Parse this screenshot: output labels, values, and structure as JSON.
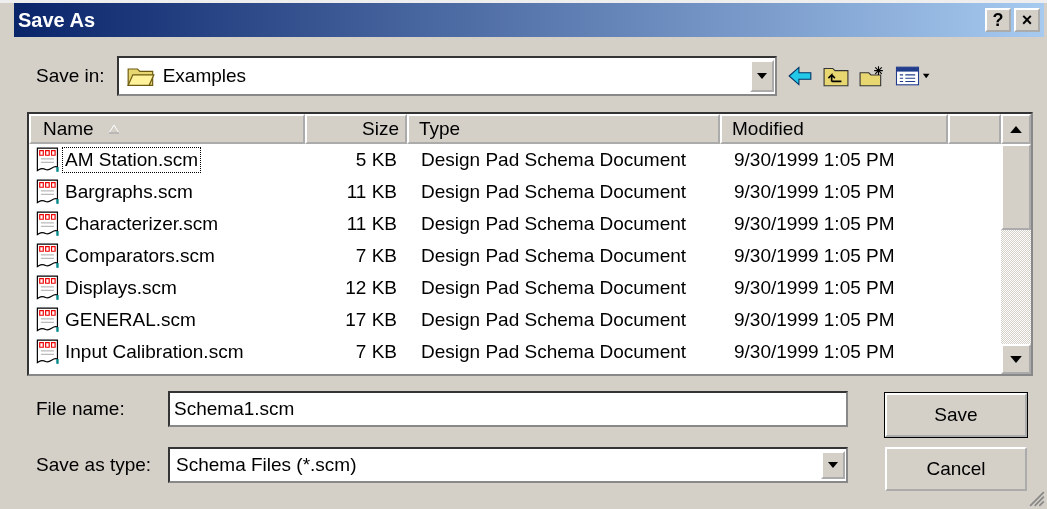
{
  "window": {
    "title": "Save As",
    "help_button": "?",
    "close_button": "×"
  },
  "save_in": {
    "label": "Save in:",
    "value": "Examples"
  },
  "table": {
    "columns": [
      "Name",
      "Size",
      "Type",
      "Modified"
    ],
    "rows": [
      {
        "name": "AM Station.scm",
        "size": "5 KB",
        "type": "Design Pad Schema Document",
        "modified": "9/30/1999 1:05 PM",
        "focused": true
      },
      {
        "name": "Bargraphs.scm",
        "size": "11 KB",
        "type": "Design Pad Schema Document",
        "modified": "9/30/1999 1:05 PM",
        "focused": false
      },
      {
        "name": "Characterizer.scm",
        "size": "11 KB",
        "type": "Design Pad Schema Document",
        "modified": "9/30/1999 1:05 PM",
        "focused": false
      },
      {
        "name": "Comparators.scm",
        "size": "7 KB",
        "type": "Design Pad Schema Document",
        "modified": "9/30/1999 1:05 PM",
        "focused": false
      },
      {
        "name": "Displays.scm",
        "size": "12 KB",
        "type": "Design Pad Schema Document",
        "modified": "9/30/1999 1:05 PM",
        "focused": false
      },
      {
        "name": "GENERAL.scm",
        "size": "17 KB",
        "type": "Design Pad Schema Document",
        "modified": "9/30/1999 1:05 PM",
        "focused": false
      },
      {
        "name": "Input Calibration.scm",
        "size": "7 KB",
        "type": "Design Pad Schema Document",
        "modified": "9/30/1999 1:05 PM",
        "focused": false
      }
    ]
  },
  "file_name": {
    "label": "File name:",
    "value": "Schema1.scm"
  },
  "save_as_type": {
    "label": "Save as type:",
    "value": "Schema Files (*.scm)"
  },
  "buttons": [
    "Save",
    "Cancel"
  ]
}
